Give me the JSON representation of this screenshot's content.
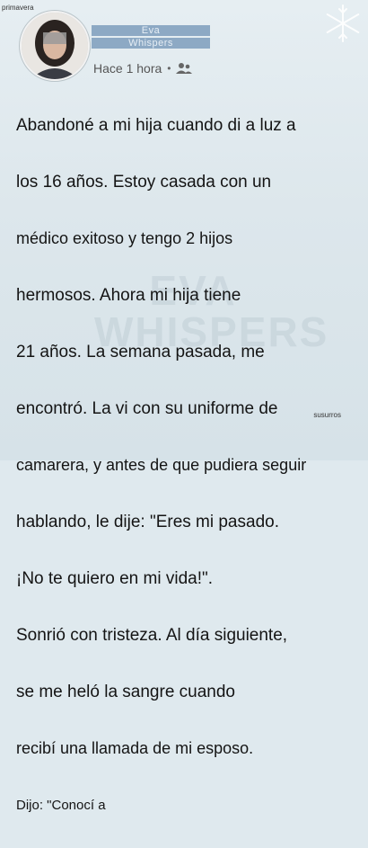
{
  "corner_tag": "primavera",
  "author": {
    "line1": "Eva",
    "line2": "Whispers"
  },
  "meta": {
    "time": "Hace 1 hora",
    "audience_icon": "friends-icon"
  },
  "watermark": "EVA WHISPERS",
  "body_lines": [
    "Abandoné a mi hija cuando di a luz a",
    "los 16 años. Estoy casada con un",
    "médico exitoso y tengo 2 hijos",
    "hermosos. Ahora mi hija tiene",
    "21 años. La semana pasada, me",
    "encontró. La vi con su uniforme de",
    "camarera, y antes de que pudiera seguir",
    "hablando, le dije: \"Eres mi pasado.",
    "¡No te quiero en mi vida!\".",
    "Sonrió con tristeza. Al día siguiente,",
    "se me heló la sangre cuando",
    "recibí una llamada de mi esposo.",
    "Dijo: \"Conocí a"
  ],
  "side_tag": "susurros",
  "colors": {
    "background": "#dfe9ee",
    "name_bar": "#8da9c4"
  }
}
